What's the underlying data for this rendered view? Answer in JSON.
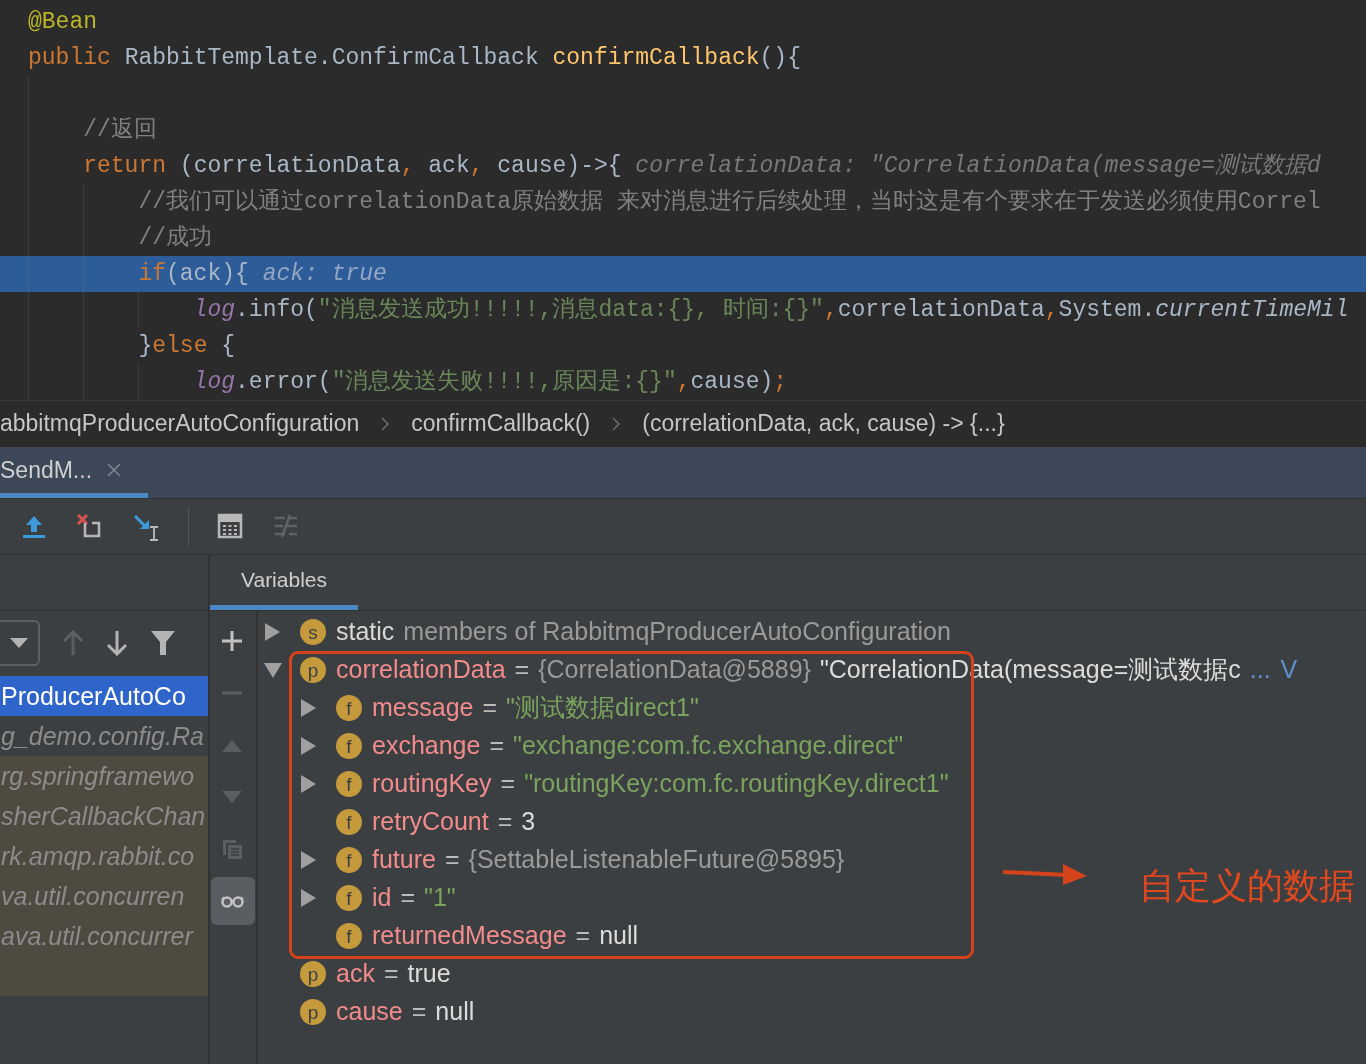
{
  "editor": {
    "lines": [
      {
        "current": false,
        "tokens": [
          {
            "text": "@Bean",
            "kind": "annotation"
          }
        ]
      },
      {
        "current": false,
        "tokens": [
          {
            "text": "public",
            "kind": "keyword"
          },
          {
            "text": " RabbitTemplate.ConfirmCallback ",
            "kind": "plain"
          },
          {
            "text": "confirmCallback",
            "kind": "method"
          },
          {
            "text": "(){",
            "kind": "plain"
          }
        ],
        "children": [
          {
            "current": false
          },
          {
            "current": false,
            "tokens": [
              {
                "text": "//返回",
                "kind": "comment"
              }
            ]
          },
          {
            "current": false,
            "tokens": [
              {
                "text": "return",
                "kind": "keyword"
              },
              {
                "text": " (correlationData",
                "kind": "plain"
              },
              {
                "text": ",",
                "kind": "punct"
              },
              {
                "text": " ack",
                "kind": "plain"
              },
              {
                "text": ",",
                "kind": "punct"
              },
              {
                "text": " cause)->{",
                "kind": "plain"
              },
              {
                "text": "correlationData: \"CorrelationData(message=测试数据d",
                "kind": "hint"
              }
            ],
            "children": [
              {
                "current": false,
                "tokens": [
                  {
                    "text": "//我们可以通过correlationData原始数据 来对消息进行后续处理，当时这是有个要求在于发送必须使用Correl",
                    "kind": "comment"
                  }
                ]
              },
              {
                "current": false,
                "tokens": [
                  {
                    "text": "//成功",
                    "kind": "comment"
                  }
                ]
              },
              {
                "current": true,
                "tokens": [
                  {
                    "text": "if",
                    "kind": "keyword"
                  },
                  {
                    "text": "(ack){",
                    "kind": "plain"
                  },
                  {
                    "text": "ack: true",
                    "kind": "hint"
                  }
                ],
                "children": [
                  {
                    "current": false,
                    "tokens": [
                      {
                        "text": "log",
                        "kind": "field"
                      },
                      {
                        "text": ".info(",
                        "kind": "plain"
                      },
                      {
                        "text": "\"消息发送成功!!!!!,消息data:{}, 时间:{}\"",
                        "kind": "string"
                      },
                      {
                        "text": ",",
                        "kind": "punct"
                      },
                      {
                        "text": "correlationData",
                        "kind": "plain"
                      },
                      {
                        "text": ",",
                        "kind": "punct"
                      },
                      {
                        "text": "System.",
                        "kind": "plain"
                      },
                      {
                        "text": "currentTimeMil",
                        "kind": "static"
                      }
                    ]
                  }
                ]
              },
              {
                "current": false,
                "tokens": [
                  {
                    "text": "}",
                    "kind": "plain"
                  },
                  {
                    "text": "else",
                    "kind": "keyword"
                  },
                  {
                    "text": " {",
                    "kind": "plain"
                  }
                ],
                "children": [
                  {
                    "current": false,
                    "tokens": [
                      {
                        "text": "log",
                        "kind": "field"
                      },
                      {
                        "text": ".error(",
                        "kind": "plain"
                      },
                      {
                        "text": "\"消息发送失败!!!!,原因是:{}\"",
                        "kind": "string"
                      },
                      {
                        "text": ",",
                        "kind": "punct"
                      },
                      {
                        "text": "cause)",
                        "kind": "plain"
                      },
                      {
                        "text": ";",
                        "kind": "punct"
                      }
                    ]
                  }
                ]
              }
            ]
          }
        ]
      }
    ]
  },
  "breadcrumb": [
    "abbitmqProducerAutoConfiguration",
    "confirmCallback()",
    "(correlationData, ack, cause) -> {...}"
  ],
  "debug_tabs": [
    {
      "label": "SendM...",
      "selected": true
    }
  ],
  "toolbar": {
    "groups": [
      [
        {
          "kind": "step-out",
          "disabled": false
        },
        {
          "kind": "drop-frame",
          "disabled": false
        },
        {
          "kind": "run-to-cursor",
          "disabled": false
        }
      ],
      [
        {
          "kind": "calculator",
          "disabled": false
        },
        {
          "kind": "trace",
          "disabled": true
        }
      ]
    ]
  },
  "frame_controls": [
    {
      "kind": "dropdown",
      "disabled": false
    },
    {
      "kind": "up",
      "disabled": true
    },
    {
      "kind": "down",
      "disabled": false
    },
    {
      "kind": "filter",
      "disabled": false
    }
  ],
  "frames": [
    {
      "label": "ProducerAutoCo",
      "selected": true,
      "library": false
    },
    {
      "label": "g_demo.config.Ra",
      "selected": false,
      "library": false
    },
    {
      "label": "rg.springframewo",
      "selected": false,
      "library": true
    },
    {
      "label": "sherCallbackChan",
      "selected": false,
      "library": true
    },
    {
      "label": "rk.amqp.rabbit.co",
      "selected": false,
      "library": true
    },
    {
      "label": "va.util.concurren",
      "selected": false,
      "library": true
    },
    {
      "label": "ava.util.concurrer",
      "selected": false,
      "library": true
    }
  ],
  "panel_tabs": [
    {
      "label": "Variables",
      "selected": true
    }
  ],
  "watch_tools": [
    {
      "kind": "add",
      "disabled": false,
      "selected": false
    },
    {
      "kind": "remove",
      "disabled": true,
      "selected": false
    },
    {
      "kind": "move-up",
      "disabled": true,
      "selected": false
    },
    {
      "kind": "move-down",
      "disabled": true,
      "selected": false
    },
    {
      "kind": "duplicate",
      "disabled": true,
      "selected": false
    },
    {
      "kind": "glasses",
      "disabled": false,
      "selected": true
    }
  ],
  "variables": [
    {
      "badge": "s",
      "expanded": false,
      "segments": [
        {
          "text": "static",
          "kind": "strong"
        },
        {
          "text": "members of RabbitmqProducerAutoConfiguration",
          "kind": "muted"
        }
      ]
    },
    {
      "badge": "p",
      "expanded": true,
      "segments": [
        {
          "text": "correlationData",
          "kind": "name"
        },
        {
          "text": "=",
          "kind": "op"
        },
        {
          "text": "{CorrelationData@5889}",
          "kind": "muted"
        },
        {
          "text": "\"CorrelationData(message=测试数据c",
          "kind": "plain"
        },
        {
          "text": "...",
          "kind": "link"
        },
        {
          "text": "V",
          "kind": "link"
        }
      ],
      "children": [
        {
          "badge": "f",
          "expanded": false,
          "segments": [
            {
              "text": "message",
              "kind": "name"
            },
            {
              "text": "=",
              "kind": "op"
            },
            {
              "text": "\"测试数据direct1\"",
              "kind": "string"
            }
          ]
        },
        {
          "badge": "f",
          "expanded": false,
          "segments": [
            {
              "text": "exchange",
              "kind": "name"
            },
            {
              "text": "=",
              "kind": "op"
            },
            {
              "text": "\"exchange:com.fc.exchange.direct\"",
              "kind": "string"
            }
          ]
        },
        {
          "badge": "f",
          "expanded": false,
          "segments": [
            {
              "text": "routingKey",
              "kind": "name"
            },
            {
              "text": "=",
              "kind": "op"
            },
            {
              "text": "\"routingKey:com.fc.routingKey.direct1\"",
              "kind": "string"
            }
          ]
        },
        {
          "badge": "f",
          "segments": [
            {
              "text": "retryCount",
              "kind": "name"
            },
            {
              "text": "=",
              "kind": "op"
            },
            {
              "text": "3",
              "kind": "plain"
            }
          ]
        },
        {
          "badge": "f",
          "expanded": false,
          "segments": [
            {
              "text": "future",
              "kind": "name"
            },
            {
              "text": "=",
              "kind": "op"
            },
            {
              "text": "{SettableListenableFuture@5895}",
              "kind": "muted"
            }
          ]
        },
        {
          "badge": "f",
          "expanded": false,
          "segments": [
            {
              "text": "id",
              "kind": "name"
            },
            {
              "text": "=",
              "kind": "op"
            },
            {
              "text": "\"1\"",
              "kind": "string"
            }
          ]
        },
        {
          "badge": "f",
          "segments": [
            {
              "text": "returnedMessage",
              "kind": "name"
            },
            {
              "text": "=",
              "kind": "op"
            },
            {
              "text": "null",
              "kind": "plain"
            }
          ]
        }
      ]
    },
    {
      "badge": "p",
      "segments": [
        {
          "text": "ack",
          "kind": "name"
        },
        {
          "text": "=",
          "kind": "op"
        },
        {
          "text": "true",
          "kind": "plain"
        }
      ]
    },
    {
      "badge": "p",
      "segments": [
        {
          "text": "cause",
          "kind": "name"
        },
        {
          "text": "=",
          "kind": "op"
        },
        {
          "text": "null",
          "kind": "plain"
        }
      ]
    }
  ],
  "annotation": {
    "text": "自定义的数据"
  }
}
